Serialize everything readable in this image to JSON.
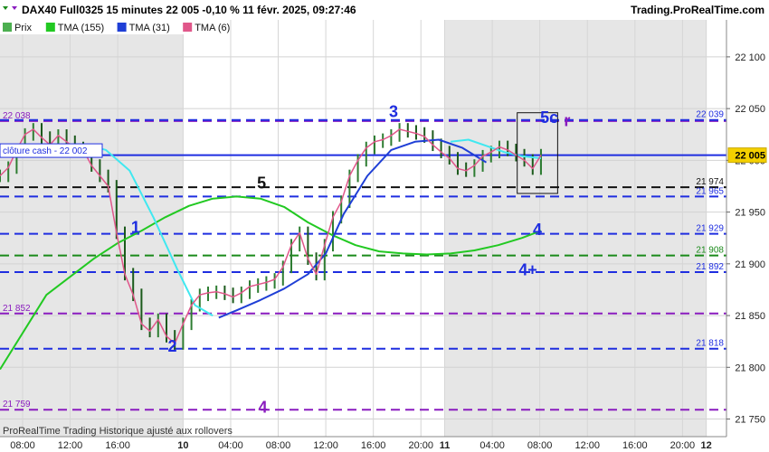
{
  "header": {
    "title": "DAX40 Full0325 15 minutes 22 005 -0,10 % 11 févr. 2025, 09:27:46",
    "brand": "Trading.ProRealTime.com"
  },
  "footer": {
    "note": "ProRealTime Trading  Historique ajusté aux rollovers"
  },
  "colors": {
    "price_up": "#2e7d32",
    "price_down": "#b71c1c",
    "tma155": "#22c922",
    "tma31": "#1f3fd6",
    "tma6": "#e0578a",
    "cyan": "#40e8f0",
    "purple": "#8a1cbf",
    "blue_level": "#1f2ee0",
    "green_level": "#1a8a1a"
  },
  "chart_data": {
    "type": "line",
    "legend": [
      {
        "label": "Prix",
        "color": "#4caf50"
      },
      {
        "label": "TMA (155)",
        "color": "#22c922"
      },
      {
        "label": "TMA (31)",
        "color": "#1f3fd6"
      },
      {
        "label": "TMA (6)",
        "color": "#e0578a"
      }
    ],
    "y_ticks": [
      21750,
      21800,
      21850,
      21900,
      21950,
      22000,
      22050,
      22100
    ],
    "y_tick_labels": [
      "21 750",
      "21 800",
      "21 850",
      "21 900",
      "21 950",
      "22 000",
      "22 050",
      "22 100"
    ],
    "ylim": [
      21733,
      22120
    ],
    "x_ticks": [
      {
        "label": "08:00",
        "bold": false,
        "x": 0
      },
      {
        "label": "12:00",
        "bold": false,
        "x": 4
      },
      {
        "label": "16:00",
        "bold": false,
        "x": 8
      },
      {
        "label": "10",
        "bold": true,
        "x": 13.5
      },
      {
        "label": "04:00",
        "bold": false,
        "x": 17.5
      },
      {
        "label": "08:00",
        "bold": false,
        "x": 21.5
      },
      {
        "label": "12:00",
        "bold": false,
        "x": 25.5
      },
      {
        "label": "16:00",
        "bold": false,
        "x": 29.5
      },
      {
        "label": "20:00",
        "bold": false,
        "x": 33.5
      },
      {
        "label": "11",
        "bold": true,
        "x": 35.5
      },
      {
        "label": "04:00",
        "bold": false,
        "x": 39.5
      },
      {
        "label": "08:00",
        "bold": false,
        "x": 43.5
      },
      {
        "label": "12:00",
        "bold": false,
        "x": 47.5
      },
      {
        "label": "16:00",
        "bold": false,
        "x": 51.5
      },
      {
        "label": "20:00",
        "bold": false,
        "x": 55.5
      },
      {
        "label": "12",
        "bold": true,
        "x": 57.5
      }
    ],
    "xlim": [
      -1.9,
      59.2
    ],
    "shaded_x": [
      [
        -1.9,
        13.5
      ],
      [
        35.5,
        57.5
      ]
    ],
    "current_price": {
      "value": 22005,
      "label": "22 005"
    },
    "cloture": {
      "value": 22002,
      "label": "clôture cash -  22 002"
    },
    "levels": [
      {
        "value": 22038,
        "label": "22 038",
        "color": "#8a1cbf",
        "side": "left"
      },
      {
        "value": 22039,
        "label": "22 039",
        "color": "#1f2ee0",
        "side": "right"
      },
      {
        "value": 21974,
        "label": "21 974",
        "color": "#111111",
        "side": "right"
      },
      {
        "value": 21965,
        "label": "21 965",
        "color": "#1f2ee0",
        "side": "right"
      },
      {
        "value": 21929,
        "label": "21 929",
        "color": "#1f2ee0",
        "side": "right"
      },
      {
        "value": 21908,
        "label": "21 908",
        "color": "#1a8a1a",
        "side": "right"
      },
      {
        "value": 21892,
        "label": "21 892",
        "color": "#1f2ee0",
        "side": "right"
      },
      {
        "value": 21852,
        "label": "21 852",
        "color": "#8a1cbf",
        "side": "left"
      },
      {
        "value": 21818,
        "label": "21 818",
        "color": "#1f2ee0",
        "side": "right"
      },
      {
        "value": 21759,
        "label": "21 759",
        "color": "#8a1cbf",
        "side": "left"
      }
    ],
    "annotations": [
      {
        "text": "1",
        "x": 9.5,
        "y": 21930,
        "color": "#1f2ee0"
      },
      {
        "text": "2",
        "x": 12.6,
        "y": 21815,
        "color": "#1f2ee0"
      },
      {
        "text": "3",
        "x": 31.2,
        "y": 22042,
        "color": "#1f2ee0"
      },
      {
        "text": "4",
        "x": 43.3,
        "y": 21928,
        "color": "#1f2ee0"
      },
      {
        "text": "4+",
        "x": 42.5,
        "y": 21889,
        "color": "#1f2ee0"
      },
      {
        "text": "4",
        "x": 20.2,
        "y": 21756,
        "color": "#8a1cbf"
      },
      {
        "text": "5",
        "x": 20.1,
        "y": 21973,
        "color": "#111111"
      },
      {
        "text": "5c",
        "x": 44.3,
        "y": 22036,
        "color": "#1f2ee0"
      },
      {
        "text": "r",
        "x": 45.8,
        "y": 22033,
        "color": "#8a1cbf"
      }
    ],
    "price": {
      "x": [
        -1.9,
        -1.2,
        -0.5,
        0.2,
        0.9,
        1.6,
        2.3,
        3.0,
        3.7,
        4.4,
        5.1,
        5.8,
        6.5,
        7.2,
        7.9,
        8.6,
        9.3,
        10.0,
        10.7,
        11.4,
        12.1,
        12.8,
        13.5,
        14.2,
        14.9,
        15.6,
        16.3,
        17.0,
        17.7,
        18.4,
        19.1,
        19.8,
        20.5,
        21.2,
        21.9,
        22.6,
        23.3,
        24.0,
        24.7,
        25.4,
        26.1,
        26.8,
        27.5,
        28.2,
        28.9,
        29.6,
        30.3,
        31.0,
        31.7,
        32.4,
        33.1,
        33.8,
        34.5,
        35.2,
        35.9,
        36.6,
        37.3,
        38.0,
        38.7,
        39.4,
        40.1,
        40.8,
        41.5,
        42.2,
        42.9,
        43.6
      ],
      "y": [
        21985,
        21993,
        22010,
        22025,
        22030,
        22022,
        22015,
        22024,
        22018,
        22012,
        22010,
        21995,
        21985,
        21975,
        21930,
        21890,
        21870,
        21842,
        21835,
        21846,
        21830,
        21823,
        21842,
        21860,
        21870,
        21872,
        21873,
        21871,
        21868,
        21872,
        21878,
        21880,
        21882,
        21885,
        21897,
        21918,
        21930,
        21905,
        21890,
        21918,
        21945,
        21960,
        21985,
        22000,
        22012,
        22018,
        22020,
        22024,
        22030,
        22028,
        22026,
        22023,
        22015,
        22008,
        22002,
        21992,
        21990,
        21995,
        22004,
        22008,
        22013,
        22010,
        22005,
        22000,
        21992,
        22005
      ]
    },
    "tma155": {
      "x": [
        -1.9,
        2,
        6,
        8,
        10,
        12,
        14,
        16,
        18,
        20,
        22,
        24,
        26,
        28,
        30,
        32,
        34,
        36,
        38,
        40,
        42,
        43.6
      ],
      "y": [
        21798,
        21870,
        21905,
        21920,
        21932,
        21945,
        21956,
        21963,
        21965,
        21963,
        21955,
        21940,
        21928,
        21918,
        21912,
        21910,
        21909,
        21910,
        21913,
        21918,
        21925,
        21932
      ]
    },
    "tma31": {
      "x": [
        16.5,
        18,
        20,
        22,
        24,
        25.5,
        27,
        29,
        31,
        33,
        35,
        37,
        39
      ],
      "y": [
        21848,
        21855,
        21865,
        21876,
        21890,
        21910,
        21948,
        21985,
        22010,
        22018,
        22020,
        22012,
        21998
      ]
    },
    "cyan": {
      "x": [
        5.5,
        7,
        9,
        11,
        13,
        14.5,
        16
      ],
      "y": [
        22015,
        22010,
        21990,
        21945,
        21895,
        21860,
        21850
      ]
    },
    "cyan2": {
      "x": [
        36,
        37.5,
        39,
        40.5,
        42,
        43.6
      ],
      "y": [
        22018,
        22020,
        22014,
        22008,
        22004,
        22002
      ]
    },
    "box": {
      "x1": 41.6,
      "x2": 45.0,
      "y1": 21968,
      "y2": 22046
    }
  }
}
